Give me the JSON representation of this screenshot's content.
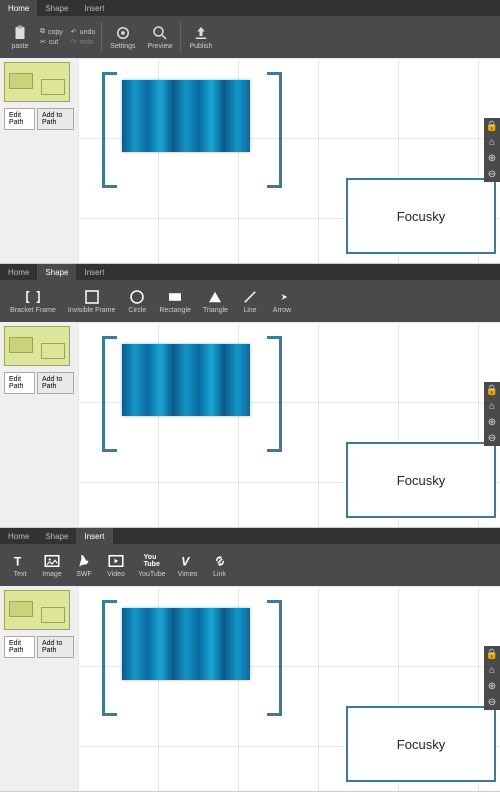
{
  "tabs": {
    "home": "Home",
    "shape": "Shape",
    "insert": "Insert"
  },
  "home_tools": {
    "paste": "paste",
    "copy": "copy",
    "cut": "cut",
    "undo": "undo",
    "redo": "redo",
    "settings": "Settings",
    "preview": "Preview",
    "publish": "Publish"
  },
  "shape_tools": {
    "bracket": "Bracket Frame",
    "invisible": "Invisible Frame",
    "circle": "Circle",
    "rectangle": "Rectangle",
    "triangle": "Triangle",
    "line": "Line",
    "arrow": "Arrow"
  },
  "insert_tools": {
    "text": "Text",
    "image": "Image",
    "swf": "SWF",
    "video": "Video",
    "youtube": "YouTube",
    "vimeo": "Vimeo",
    "link": "Link"
  },
  "sidebar": {
    "edit_path": "Edit Path",
    "add_to_path": "Add to Path"
  },
  "canvas": {
    "focusky": "Focusky"
  }
}
